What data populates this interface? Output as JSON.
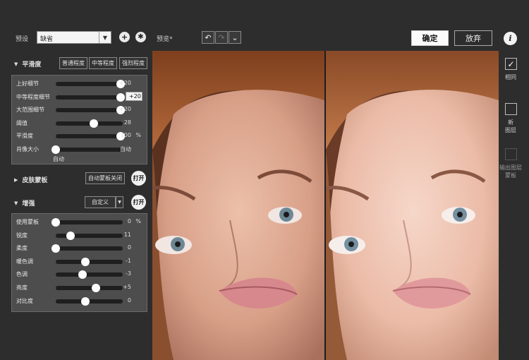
{
  "topbar": {
    "preset_label": "预设",
    "preset_value": "缺省",
    "add_icon": "+",
    "settings_icon": "gear",
    "preview_label": "预览*",
    "undo_icon": "↶",
    "redo_icon": "↷",
    "history_icon": "chevron-down",
    "ok_label": "确定",
    "cancel_label": "放弃",
    "info_icon": "i"
  },
  "smoothing": {
    "title": "平滑度",
    "tabs": [
      "普通程度",
      "中等程度",
      "强烈程度"
    ],
    "rows": [
      {
        "label": "上好细节",
        "value": "+20",
        "fraction": 0.97,
        "unit": ""
      },
      {
        "label": "中等程度细节",
        "value": "+20",
        "fraction": 0.97,
        "unit": ""
      },
      {
        "label": "大范围细节",
        "value": "+20",
        "fraction": 0.97,
        "unit": ""
      },
      {
        "label": "阈值",
        "value": "28",
        "fraction": 0.57,
        "unit": ""
      },
      {
        "label": "平滑度",
        "value": "100",
        "fraction": 0.97,
        "unit": "%"
      },
      {
        "label": "肖像大小",
        "value": "自动",
        "fraction": 0.0,
        "unit": ""
      }
    ],
    "auto_text": "自动"
  },
  "skin_mask": {
    "title": "皮肤蒙板",
    "mode_label": "自动蒙板关闭",
    "open_label": "打开"
  },
  "enhance": {
    "title": "增强",
    "mode_label": "自定义",
    "open_label": "打开",
    "rows": [
      {
        "label": "使用蒙板",
        "value": "0",
        "fraction": 0.0,
        "unit": "%"
      },
      {
        "label": "锐度",
        "value": "11",
        "fraction": 0.22,
        "unit": ""
      },
      {
        "label": "柔度",
        "value": "0",
        "fraction": 0.0,
        "unit": ""
      },
      {
        "label": "暖色调",
        "value": "-1",
        "fraction": 0.44,
        "unit": ""
      },
      {
        "label": "色调",
        "value": "-3",
        "fraction": 0.4,
        "unit": ""
      },
      {
        "label": "亮度",
        "value": "+5",
        "fraction": 0.6,
        "unit": ""
      },
      {
        "label": "对比度",
        "value": "0",
        "fraction": 0.44,
        "unit": ""
      }
    ]
  },
  "right_strip": {
    "same_label": "相同",
    "new_layer_label": "新\n图层",
    "output_layer_mask_label": "输出图层\n蒙板"
  },
  "colors": {
    "accent": "#ffffff",
    "panel": "#4d4d4d",
    "background": "#2d2d2d"
  }
}
